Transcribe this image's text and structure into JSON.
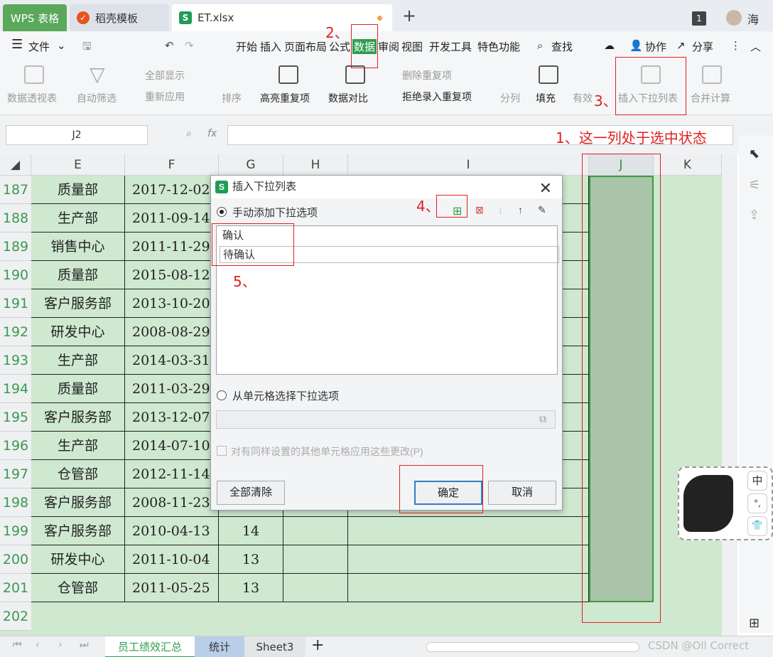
{
  "title_tabs": {
    "wps": "WPS 表格",
    "daoke": "稻壳模板",
    "file": "ET.xlsx",
    "badge": "1",
    "user": "海"
  },
  "menu": {
    "file": "文件",
    "items": [
      "开始",
      "插入",
      "页面布局",
      "公式",
      "数据",
      "审阅",
      "视图",
      "开发工具",
      "特色功能"
    ],
    "search": "查找",
    "collab": "协作",
    "share": "分享"
  },
  "ribbon": {
    "pivot": "数据透视表",
    "autofilter": "自动筛选",
    "show_all": "全部显示",
    "reapply": "重新应用",
    "sort": "排序",
    "highlight_dup": "高亮重复项",
    "compare": "数据对比",
    "remove_dup": "删除重复项",
    "reject_dup": "拒绝录入重复项",
    "split": "分列",
    "fill": "填充",
    "validity": "有效",
    "insert_dropdown": "插入下拉列表",
    "merge_calc": "合并计算"
  },
  "formula_bar": {
    "name_box": "J2",
    "fx": "fx"
  },
  "columns": [
    "E",
    "F",
    "G",
    "H",
    "I",
    "J",
    "K"
  ],
  "rows": [
    {
      "num": "187",
      "e": "质量部",
      "f": "2017-12-02",
      "g": ""
    },
    {
      "num": "188",
      "e": "生产部",
      "f": "2011-09-14",
      "g": ""
    },
    {
      "num": "189",
      "e": "销售中心",
      "f": "2011-11-29",
      "g": ""
    },
    {
      "num": "190",
      "e": "质量部",
      "f": "2015-08-12",
      "g": ""
    },
    {
      "num": "191",
      "e": "客户服务部",
      "f": "2013-10-20",
      "g": ""
    },
    {
      "num": "192",
      "e": "研发中心",
      "f": "2008-08-29",
      "g": ""
    },
    {
      "num": "193",
      "e": "生产部",
      "f": "2014-03-31",
      "g": ""
    },
    {
      "num": "194",
      "e": "质量部",
      "f": "2011-03-29",
      "g": ""
    },
    {
      "num": "195",
      "e": "客户服务部",
      "f": "2013-12-07",
      "g": ""
    },
    {
      "num": "196",
      "e": "生产部",
      "f": "2014-07-10",
      "g": ""
    },
    {
      "num": "197",
      "e": "仓管部",
      "f": "2012-11-14",
      "g": ""
    },
    {
      "num": "198",
      "e": "客户服务部",
      "f": "2008-11-23",
      "g": ""
    },
    {
      "num": "199",
      "e": "客户服务部",
      "f": "2010-04-13",
      "g": "14"
    },
    {
      "num": "200",
      "e": "研发中心",
      "f": "2011-10-04",
      "g": "13"
    },
    {
      "num": "201",
      "e": "仓管部",
      "f": "2011-05-25",
      "g": "13"
    },
    {
      "num": "202",
      "e": "",
      "f": "",
      "g": ""
    }
  ],
  "sheets": [
    "员工绩效汇总",
    "统计",
    "Sheet3"
  ],
  "dialog": {
    "title": "插入下拉列表",
    "manual_option": "手动添加下拉选项",
    "items": [
      "确认",
      "待确认"
    ],
    "cell_option": "从单元格选择下拉选项",
    "apply_same": "对有同样设置的其他单元格应用这些更改(P)",
    "clear_all": "全部清除",
    "ok": "确定",
    "cancel": "取消"
  },
  "annotations": {
    "step1": "1、这一列处于选中状态",
    "step2": "2、",
    "step3": "3、",
    "step4": "4、",
    "step5": "5、"
  },
  "ime": {
    "lang": "中",
    "punct": "°,",
    "skin": "👕"
  },
  "watermark": "CSDN @Oll Correct",
  "colors": {
    "accent_green": "#2f9d4f",
    "annotation_red": "#e02020",
    "selection_border": "#3a9e3a"
  }
}
